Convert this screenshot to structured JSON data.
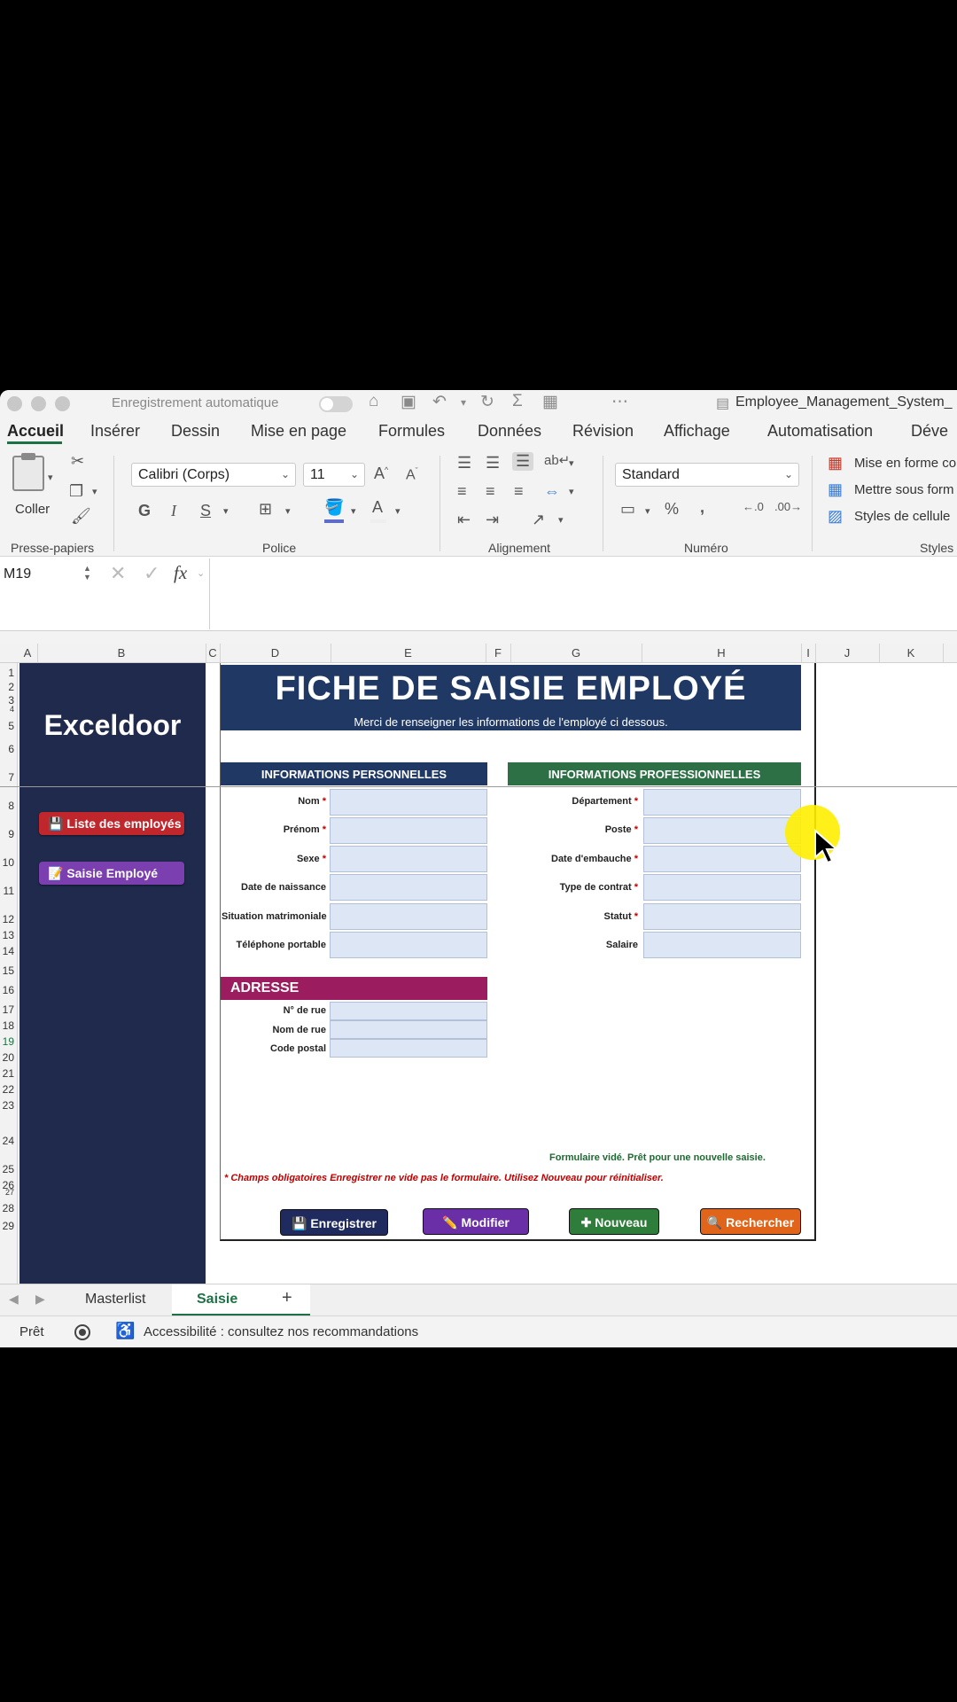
{
  "window": {
    "autosave_label": "Enregistrement automatique",
    "file_name": "Employee_Management_System_"
  },
  "ribbon_tabs": [
    "Accueil",
    "Insérer",
    "Dessin",
    "Mise en page",
    "Formules",
    "Données",
    "Révision",
    "Affichage",
    "Automatisation",
    "Déve"
  ],
  "ribbon": {
    "paste_label": "Coller",
    "clipboard_group": "Presse-papiers",
    "font_name": "Calibri (Corps)",
    "font_size": "11",
    "bold": "G",
    "italic": "I",
    "underline": "S",
    "font_group": "Police",
    "alignment_group": "Alignement",
    "number_format": "Standard",
    "number_group": "Numéro",
    "styles_items": [
      "Mise en forme co",
      "Mettre sous form",
      "Styles de cellule"
    ],
    "styles_group": "Styles"
  },
  "formula_bar": {
    "cell_ref": "M19",
    "fx": "fx",
    "value": ""
  },
  "columns": [
    "A",
    "B",
    "C",
    "D",
    "E",
    "F",
    "G",
    "H",
    "I",
    "J",
    "K"
  ],
  "rows": [
    "1",
    "2",
    "3",
    "4",
    "5",
    "6",
    "7",
    "8",
    "9",
    "10",
    "11",
    "12",
    "13",
    "14",
    "15",
    "16",
    "17",
    "18",
    "19",
    "20",
    "21",
    "22",
    "23",
    "24",
    "25",
    "26",
    "27",
    "28",
    "29"
  ],
  "sidebar": {
    "brand": "Exceldoor",
    "buttons": [
      {
        "icon": "💾",
        "label": "Liste des employés",
        "color": "#c0272d"
      },
      {
        "icon": "📝",
        "label": "Saisie Employé",
        "color": "#7b3fb0"
      }
    ]
  },
  "form": {
    "title": "FICHE DE SAISIE EMPLOYÉ",
    "subtitle": "Merci de renseigner les informations de l'employé ci dessous.",
    "personal": {
      "header": "INFORMATIONS PERSONNELLES",
      "color": "#1f3864",
      "fields": [
        {
          "label": "Nom",
          "required": "*"
        },
        {
          "label": "Prénom",
          "required": "*"
        },
        {
          "label": "Sexe",
          "required": "*"
        },
        {
          "label": "Date de naissance",
          "required": ""
        },
        {
          "label": "Situation matrimoniale",
          "required": ""
        },
        {
          "label": "Téléphone portable",
          "required": ""
        }
      ]
    },
    "professional": {
      "header": "INFORMATIONS PROFESSIONNELLES",
      "color": "#2e7045",
      "fields": [
        {
          "label": "Département",
          "required": "*"
        },
        {
          "label": "Poste",
          "required": "*"
        },
        {
          "label": "Date d'embauche",
          "required": "*"
        },
        {
          "label": "Type de contrat",
          "required": "*"
        },
        {
          "label": "Statut",
          "required": "*"
        },
        {
          "label": "Salaire",
          "required": ""
        }
      ]
    },
    "address": {
      "header": "ADRESSE",
      "color": "#9b1c5f",
      "fields": [
        {
          "label": "N° de rue"
        },
        {
          "label": "Nom de rue"
        },
        {
          "label": "Code postal"
        }
      ]
    },
    "status_message": "Formulaire vidé. Prêt pour une nouvelle saisie.",
    "note": "* Champs obligatoires  Enregistrer ne vide pas le formulaire. Utilisez Nouveau pour réinitialiser.",
    "actions": [
      {
        "icon": "💾",
        "label": "Enregistrer",
        "color": "#1f2a5e"
      },
      {
        "icon": "✏️",
        "label": "Modifier",
        "color": "#6a2ea6"
      },
      {
        "icon": "✚",
        "label": "Nouveau",
        "color": "#2e7d3a"
      },
      {
        "icon": "🔍",
        "label": "Rechercher",
        "color": "#e0641a"
      }
    ]
  },
  "sheet_tabs": [
    "Masterlist",
    "Saisie"
  ],
  "active_sheet": "Saisie",
  "status_bar": {
    "ready": "Prêt",
    "accessibility": "Accessibilité : consultez nos recommandations"
  }
}
